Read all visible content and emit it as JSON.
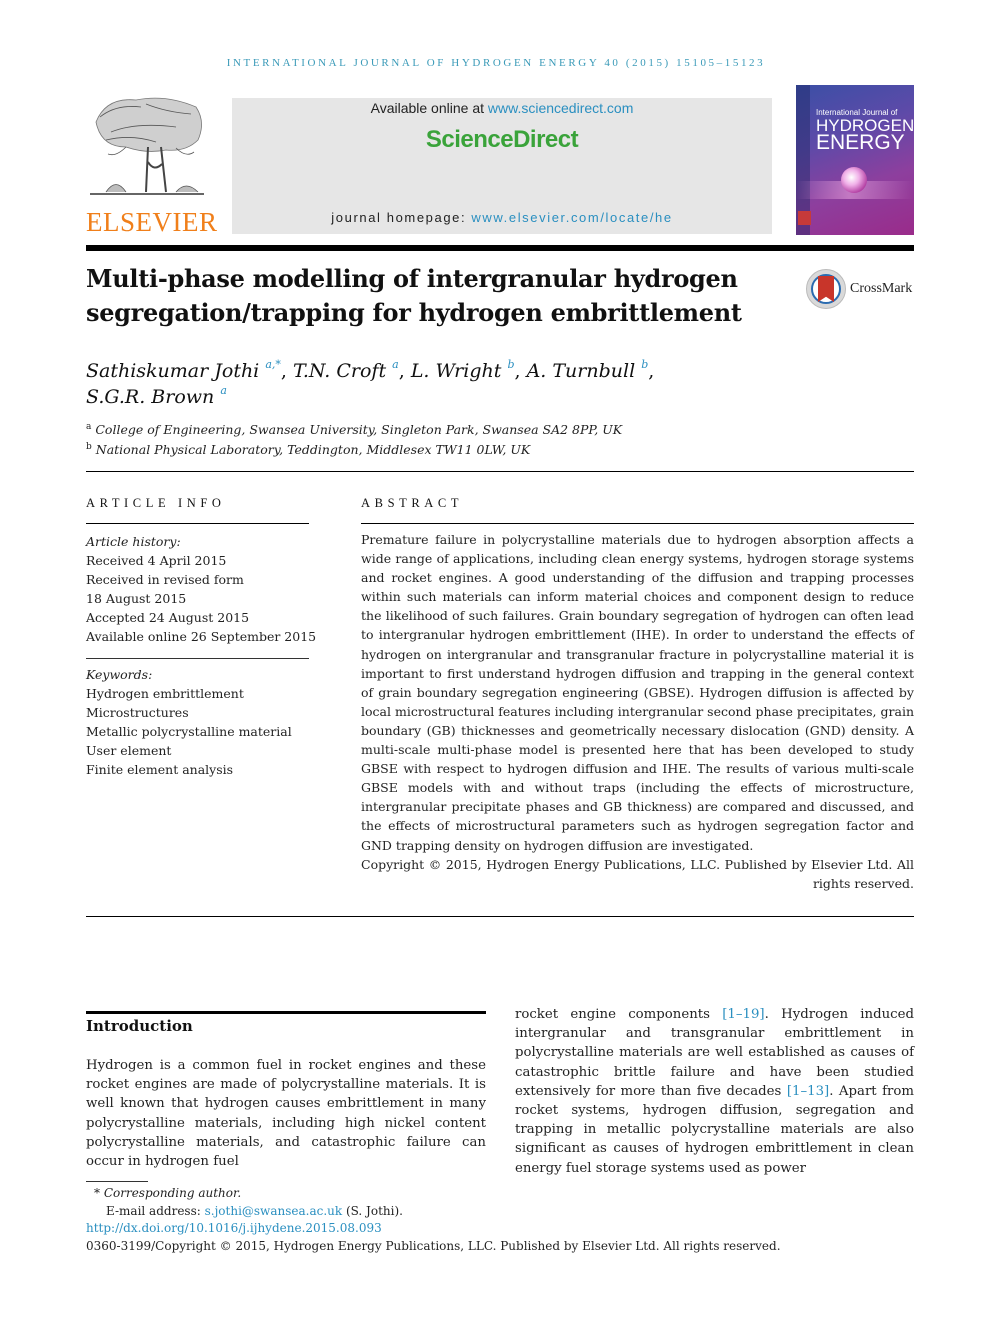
{
  "running_head": "INTERNATIONAL JOURNAL OF HYDROGEN ENERGY 40 (2015) 15105–15123",
  "publisher": {
    "logo_word": "ELSEVIER",
    "logo_color": "#f07f1a"
  },
  "sciencedirect": {
    "available_prefix": "Available online at ",
    "available_link": "www.sciencedirect.com",
    "brand": "ScienceDirect",
    "brand_color": "#3aa33a",
    "homepage_prefix": "journal homepage: ",
    "homepage_link": "www.elsevier.com/locate/he"
  },
  "journal_cover": {
    "line1": "International Journal of",
    "line2": "HYDROGEN",
    "line3": "ENERGY"
  },
  "article": {
    "title_line1": "Multi-phase modelling of intergranular hydrogen",
    "title_line2": "segregation/trapping for hydrogen embrittlement",
    "crossmark_label": "CrossMark",
    "authors": [
      {
        "name": "Sathiskumar Jothi",
        "sup": "a,*",
        "sep": ", "
      },
      {
        "name": "T.N. Croft",
        "sup": "a",
        "sep": ", "
      },
      {
        "name": "L. Wright",
        "sup": "b",
        "sep": ", "
      },
      {
        "name": "A. Turnbull",
        "sup": "b",
        "sep": ","
      },
      {
        "name": "S.G.R. Brown",
        "sup": "a",
        "sep": ""
      }
    ],
    "affiliations": [
      {
        "key": "a",
        "text": "College of Engineering, Swansea University, Singleton Park, Swansea SA2 8PP, UK"
      },
      {
        "key": "b",
        "text": "National Physical Laboratory, Teddington, Middlesex TW11 0LW, UK"
      }
    ]
  },
  "article_info": {
    "heading": "ARTICLE INFO",
    "history_label": "Article history:",
    "history": [
      "Received 4 April 2015",
      "Received in revised form",
      "18 August 2015",
      "Accepted 24 August 2015",
      "Available online 26 September 2015"
    ],
    "keywords_label": "Keywords:",
    "keywords": [
      "Hydrogen embrittlement",
      "Microstructures",
      "Metallic polycrystalline material",
      "User element",
      "Finite element analysis"
    ]
  },
  "abstract": {
    "heading": "ABSTRACT",
    "body": "Premature failure in polycrystalline materials due to hydrogen absorption affects a wide range of applications, including clean energy systems, hydrogen storage systems and rocket engines. A good understanding of the diffusion and trapping processes within such materials can inform material choices and component design to reduce the likelihood of such failures. Grain boundary segregation of hydrogen can often lead to intergranular hydrogen embrittlement (IHE). In order to understand the effects of hydrogen on intergranular and transgranular fracture in polycrystalline material it is important to first understand hydrogen diffusion and trapping in the general context of grain boundary segregation engineering (GBSE). Hydrogen diffusion is affected by local microstructural features including intergranular second phase precipitates, grain boundary (GB) thicknesses and geometrically necessary dislocation (GND) density. A multi-scale multi-phase model is presented here that has been developed to study GBSE with respect to hydrogen diffusion and IHE. The results of various multi-scale GBSE models with and without traps (including the effects of microstructure, intergranular precipitate phases and GB thickness) are compared and discussed, and the effects of microstructural parameters such as hydrogen segregation factor and GND trapping density on hydrogen diffusion are investigated.",
    "copyright": "Copyright © 2015, Hydrogen Energy Publications, LLC. Published by Elsevier Ltd. All rights reserved."
  },
  "introduction": {
    "heading": "Introduction",
    "left_text": "Hydrogen is a common fuel in rocket engines and these rocket engines are made of polycrystalline materials. It is well known that hydrogen causes embrittlement in many polycrystalline materials, including high nickel content polycrystalline materials, and catastrophic failure can occur in hydrogen fuel",
    "right_part1": "rocket engine components ",
    "ref1": "[1–19]",
    "right_part2": ". Hydrogen induced intergranular and transgranular embrittlement in polycrystalline materials are well established as causes of catastrophic brittle failure and have been studied extensively for more than five decades ",
    "ref2": "[1–13]",
    "right_part3": ". Apart from rocket systems, hydrogen diffusion, segregation and trapping in metallic polycrystalline materials are also significant as causes of hydrogen embrittlement in clean energy fuel storage systems used as power"
  },
  "footnotes": {
    "star": "*",
    "corresponding": "Corresponding author.",
    "email_label": "E-mail address: ",
    "email": "s.jothi@swansea.ac.uk",
    "email_suffix": " (S. Jothi).",
    "doi": "http://dx.doi.org/10.1016/j.ijhydene.2015.08.093",
    "issn_copyright": "0360-3199/Copyright © 2015, Hydrogen Energy Publications, LLC. Published by Elsevier Ltd. All rights reserved."
  }
}
